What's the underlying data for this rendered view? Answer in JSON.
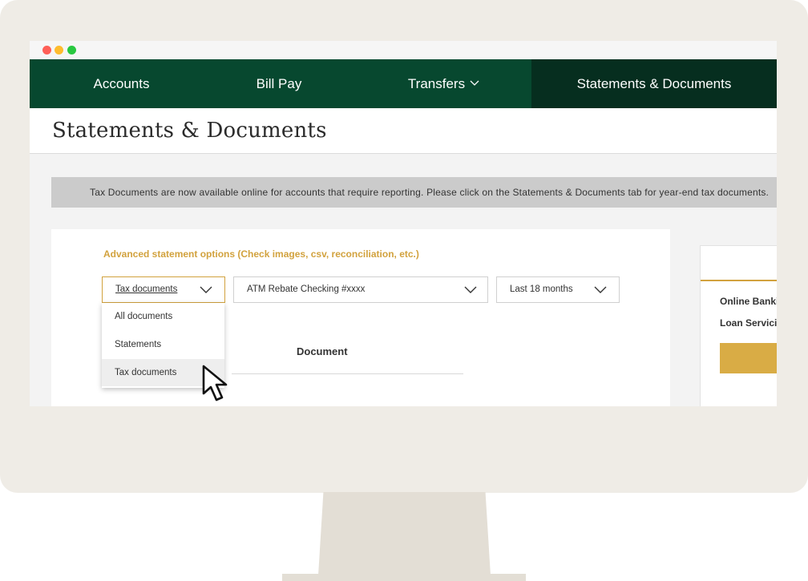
{
  "nav": {
    "items": [
      {
        "label": "Accounts"
      },
      {
        "label": "Bill Pay"
      },
      {
        "label": "Transfers"
      },
      {
        "label": "Statements & Documents"
      }
    ],
    "transfers_chevron": "chevron-down-icon"
  },
  "page": {
    "title": "Statements & Documents"
  },
  "banner": {
    "text": "Tax Documents are now available online for accounts that require reporting. Please click on the Statements & Documents tab for year-end tax documents."
  },
  "statements": {
    "advanced_link": "Advanced statement options (Check images, csv, reconciliation, etc.)",
    "document_type": {
      "selected": "Tax documents",
      "options": [
        "All documents",
        "Statements",
        "Tax documents"
      ],
      "highlighted": "Tax documents"
    },
    "account": {
      "selected": "ATM Rebate Checking #xxxx"
    },
    "period": {
      "selected": "Last 18 months"
    },
    "table_header": "Document"
  },
  "side_panel": {
    "links": [
      "Online Banki",
      "Loan Servici"
    ]
  },
  "colors": {
    "nav_bg": "#07482f",
    "nav_active_bg": "#062e1f",
    "accent_gold": "#d2a23e",
    "button_gold": "#d9ac45"
  }
}
